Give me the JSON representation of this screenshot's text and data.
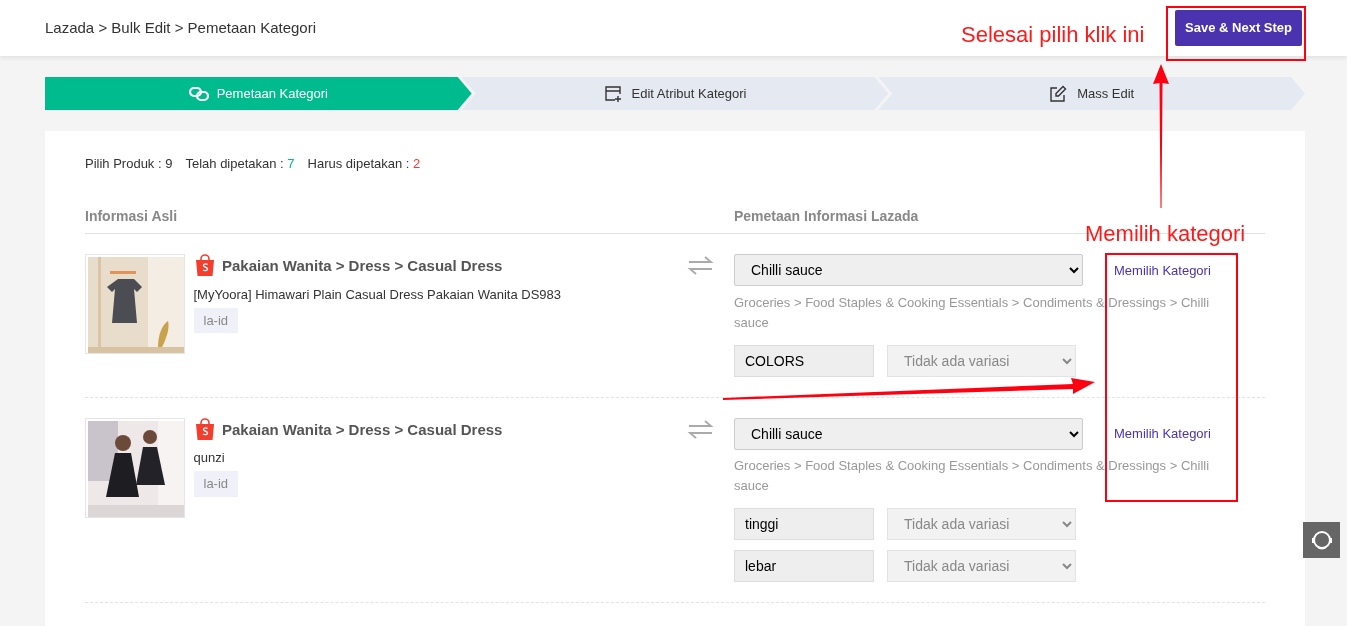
{
  "breadcrumb": "Lazada > Bulk Edit > Pemetaan Kategori",
  "save_button": "Save & Next Step",
  "steps": [
    {
      "label": "Pemetaan Kategori",
      "selected": true,
      "kind": "link"
    },
    {
      "label": "Edit Atribut Kategori",
      "selected": false,
      "kind": "add"
    },
    {
      "label": "Mass Edit",
      "selected": false,
      "kind": "edit"
    }
  ],
  "stats": [
    {
      "label": "Pilih Produk :",
      "value": "9",
      "kind": "plain"
    },
    {
      "label": "Telah dipetakan :",
      "value": "7",
      "kind": "done"
    },
    {
      "label": "Harus dipetakan :",
      "value": "2",
      "kind": "todo"
    }
  ],
  "columns": [
    "Informasi Asli",
    "Pemetaan Informasi Lazada"
  ],
  "products": [
    {
      "category": "Pakaian Wanita > Dress > Casual Dress",
      "name": "[MyYoora] Himawari Plain Casual Dress Pakaian Wanita DS983",
      "tag": "la-id",
      "lazada_category": "Chilli sauce",
      "link": "Memilih Kategori",
      "path": "Groceries > Food Staples & Cooking Essentials > Condiments & Dressings > Chilli sauce",
      "variations": [
        {
          "name": "COLORS",
          "placeholder": "Tidak ada variasi"
        }
      ]
    },
    {
      "category": "Pakaian Wanita > Dress > Casual Dress",
      "name": "qunzi",
      "tag": "la-id",
      "lazada_category": "Chilli sauce",
      "link": "Memilih Kategori",
      "path": "Groceries > Food Staples & Cooking Essentials > Condiments & Dressings > Chilli sauce",
      "variations": [
        {
          "name": "tinggi",
          "placeholder": "Tidak ada variasi"
        },
        {
          "name": "lebar",
          "placeholder": "Tidak ada variasi"
        }
      ]
    }
  ],
  "annotations": [
    {
      "text": "Selesai pilih klik ini"
    },
    {
      "text": "Memilih kategori"
    }
  ]
}
